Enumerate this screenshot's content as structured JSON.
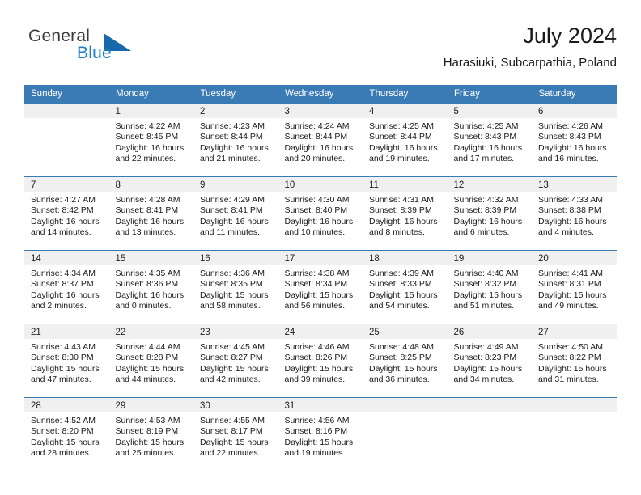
{
  "brand": {
    "word_one": "General",
    "word_two": "Blue",
    "triangle_color": "#1769ab",
    "blue_color": "#1f7fc4"
  },
  "header": {
    "title": "July 2024",
    "location": "Harasiuki, Subcarpathia, Poland",
    "header_bg": "#3a7ab5",
    "daynum_bg": "#f0f0f0"
  },
  "weekdays": [
    "Sunday",
    "Monday",
    "Tuesday",
    "Wednesday",
    "Thursday",
    "Friday",
    "Saturday"
  ],
  "labels": {
    "sunrise": "Sunrise:",
    "sunset": "Sunset:",
    "daylight": "Daylight:"
  },
  "weeks": [
    [
      {
        "day": "",
        "sunrise": "",
        "sunset": "",
        "daylight1": "",
        "daylight2": ""
      },
      {
        "day": "1",
        "sunrise": "Sunrise: 4:22 AM",
        "sunset": "Sunset: 8:45 PM",
        "daylight1": "Daylight: 16 hours",
        "daylight2": "and 22 minutes."
      },
      {
        "day": "2",
        "sunrise": "Sunrise: 4:23 AM",
        "sunset": "Sunset: 8:44 PM",
        "daylight1": "Daylight: 16 hours",
        "daylight2": "and 21 minutes."
      },
      {
        "day": "3",
        "sunrise": "Sunrise: 4:24 AM",
        "sunset": "Sunset: 8:44 PM",
        "daylight1": "Daylight: 16 hours",
        "daylight2": "and 20 minutes."
      },
      {
        "day": "4",
        "sunrise": "Sunrise: 4:25 AM",
        "sunset": "Sunset: 8:44 PM",
        "daylight1": "Daylight: 16 hours",
        "daylight2": "and 19 minutes."
      },
      {
        "day": "5",
        "sunrise": "Sunrise: 4:25 AM",
        "sunset": "Sunset: 8:43 PM",
        "daylight1": "Daylight: 16 hours",
        "daylight2": "and 17 minutes."
      },
      {
        "day": "6",
        "sunrise": "Sunrise: 4:26 AM",
        "sunset": "Sunset: 8:43 PM",
        "daylight1": "Daylight: 16 hours",
        "daylight2": "and 16 minutes."
      }
    ],
    [
      {
        "day": "7",
        "sunrise": "Sunrise: 4:27 AM",
        "sunset": "Sunset: 8:42 PM",
        "daylight1": "Daylight: 16 hours",
        "daylight2": "and 14 minutes."
      },
      {
        "day": "8",
        "sunrise": "Sunrise: 4:28 AM",
        "sunset": "Sunset: 8:41 PM",
        "daylight1": "Daylight: 16 hours",
        "daylight2": "and 13 minutes."
      },
      {
        "day": "9",
        "sunrise": "Sunrise: 4:29 AM",
        "sunset": "Sunset: 8:41 PM",
        "daylight1": "Daylight: 16 hours",
        "daylight2": "and 11 minutes."
      },
      {
        "day": "10",
        "sunrise": "Sunrise: 4:30 AM",
        "sunset": "Sunset: 8:40 PM",
        "daylight1": "Daylight: 16 hours",
        "daylight2": "and 10 minutes."
      },
      {
        "day": "11",
        "sunrise": "Sunrise: 4:31 AM",
        "sunset": "Sunset: 8:39 PM",
        "daylight1": "Daylight: 16 hours",
        "daylight2": "and 8 minutes."
      },
      {
        "day": "12",
        "sunrise": "Sunrise: 4:32 AM",
        "sunset": "Sunset: 8:39 PM",
        "daylight1": "Daylight: 16 hours",
        "daylight2": "and 6 minutes."
      },
      {
        "day": "13",
        "sunrise": "Sunrise: 4:33 AM",
        "sunset": "Sunset: 8:38 PM",
        "daylight1": "Daylight: 16 hours",
        "daylight2": "and 4 minutes."
      }
    ],
    [
      {
        "day": "14",
        "sunrise": "Sunrise: 4:34 AM",
        "sunset": "Sunset: 8:37 PM",
        "daylight1": "Daylight: 16 hours",
        "daylight2": "and 2 minutes."
      },
      {
        "day": "15",
        "sunrise": "Sunrise: 4:35 AM",
        "sunset": "Sunset: 8:36 PM",
        "daylight1": "Daylight: 16 hours",
        "daylight2": "and 0 minutes."
      },
      {
        "day": "16",
        "sunrise": "Sunrise: 4:36 AM",
        "sunset": "Sunset: 8:35 PM",
        "daylight1": "Daylight: 15 hours",
        "daylight2": "and 58 minutes."
      },
      {
        "day": "17",
        "sunrise": "Sunrise: 4:38 AM",
        "sunset": "Sunset: 8:34 PM",
        "daylight1": "Daylight: 15 hours",
        "daylight2": "and 56 minutes."
      },
      {
        "day": "18",
        "sunrise": "Sunrise: 4:39 AM",
        "sunset": "Sunset: 8:33 PM",
        "daylight1": "Daylight: 15 hours",
        "daylight2": "and 54 minutes."
      },
      {
        "day": "19",
        "sunrise": "Sunrise: 4:40 AM",
        "sunset": "Sunset: 8:32 PM",
        "daylight1": "Daylight: 15 hours",
        "daylight2": "and 51 minutes."
      },
      {
        "day": "20",
        "sunrise": "Sunrise: 4:41 AM",
        "sunset": "Sunset: 8:31 PM",
        "daylight1": "Daylight: 15 hours",
        "daylight2": "and 49 minutes."
      }
    ],
    [
      {
        "day": "21",
        "sunrise": "Sunrise: 4:43 AM",
        "sunset": "Sunset: 8:30 PM",
        "daylight1": "Daylight: 15 hours",
        "daylight2": "and 47 minutes."
      },
      {
        "day": "22",
        "sunrise": "Sunrise: 4:44 AM",
        "sunset": "Sunset: 8:28 PM",
        "daylight1": "Daylight: 15 hours",
        "daylight2": "and 44 minutes."
      },
      {
        "day": "23",
        "sunrise": "Sunrise: 4:45 AM",
        "sunset": "Sunset: 8:27 PM",
        "daylight1": "Daylight: 15 hours",
        "daylight2": "and 42 minutes."
      },
      {
        "day": "24",
        "sunrise": "Sunrise: 4:46 AM",
        "sunset": "Sunset: 8:26 PM",
        "daylight1": "Daylight: 15 hours",
        "daylight2": "and 39 minutes."
      },
      {
        "day": "25",
        "sunrise": "Sunrise: 4:48 AM",
        "sunset": "Sunset: 8:25 PM",
        "daylight1": "Daylight: 15 hours",
        "daylight2": "and 36 minutes."
      },
      {
        "day": "26",
        "sunrise": "Sunrise: 4:49 AM",
        "sunset": "Sunset: 8:23 PM",
        "daylight1": "Daylight: 15 hours",
        "daylight2": "and 34 minutes."
      },
      {
        "day": "27",
        "sunrise": "Sunrise: 4:50 AM",
        "sunset": "Sunset: 8:22 PM",
        "daylight1": "Daylight: 15 hours",
        "daylight2": "and 31 minutes."
      }
    ],
    [
      {
        "day": "28",
        "sunrise": "Sunrise: 4:52 AM",
        "sunset": "Sunset: 8:20 PM",
        "daylight1": "Daylight: 15 hours",
        "daylight2": "and 28 minutes."
      },
      {
        "day": "29",
        "sunrise": "Sunrise: 4:53 AM",
        "sunset": "Sunset: 8:19 PM",
        "daylight1": "Daylight: 15 hours",
        "daylight2": "and 25 minutes."
      },
      {
        "day": "30",
        "sunrise": "Sunrise: 4:55 AM",
        "sunset": "Sunset: 8:17 PM",
        "daylight1": "Daylight: 15 hours",
        "daylight2": "and 22 minutes."
      },
      {
        "day": "31",
        "sunrise": "Sunrise: 4:56 AM",
        "sunset": "Sunset: 8:16 PM",
        "daylight1": "Daylight: 15 hours",
        "daylight2": "and 19 minutes."
      },
      {
        "day": "",
        "sunrise": "",
        "sunset": "",
        "daylight1": "",
        "daylight2": ""
      },
      {
        "day": "",
        "sunrise": "",
        "sunset": "",
        "daylight1": "",
        "daylight2": ""
      },
      {
        "day": "",
        "sunrise": "",
        "sunset": "",
        "daylight1": "",
        "daylight2": ""
      }
    ]
  ]
}
